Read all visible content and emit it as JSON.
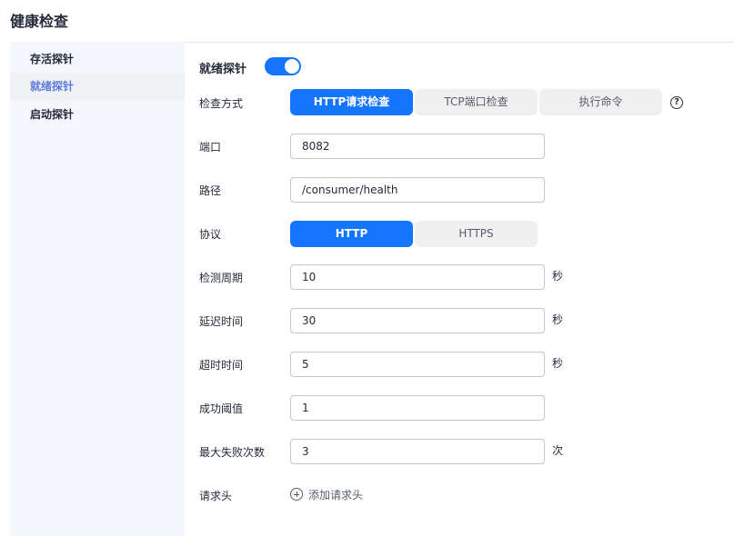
{
  "page": {
    "title": "健康检查"
  },
  "sidebar": {
    "items": [
      {
        "label": "存活探针",
        "active": false
      },
      {
        "label": "就绪探针",
        "active": true
      },
      {
        "label": "启动探针",
        "active": false
      }
    ]
  },
  "probe": {
    "title": "就绪探针",
    "enabled": true
  },
  "form": {
    "check_method": {
      "label": "检查方式",
      "options": [
        "HTTP请求检查",
        "TCP端口检查",
        "执行命令"
      ],
      "selected": "HTTP请求检查",
      "help_icon": "question-circle-icon"
    },
    "port": {
      "label": "端口",
      "value": "8082"
    },
    "path": {
      "label": "路径",
      "value": "/consumer/health"
    },
    "protocol": {
      "label": "协议",
      "options": [
        "HTTP",
        "HTTPS"
      ],
      "selected": "HTTP"
    },
    "period": {
      "label": "检测周期",
      "value": "10",
      "unit": "秒"
    },
    "delay": {
      "label": "延迟时间",
      "value": "30",
      "unit": "秒"
    },
    "timeout": {
      "label": "超时时间",
      "value": "5",
      "unit": "秒"
    },
    "success_threshold": {
      "label": "成功阈值",
      "value": "1"
    },
    "max_failures": {
      "label": "最大失败次数",
      "value": "3",
      "unit": "次"
    },
    "headers": {
      "label": "请求头",
      "add_label": "添加请求头",
      "add_icon": "plus-circle-icon"
    }
  },
  "colors": {
    "primary": "#1476ff",
    "sidebar_bg": "#f3f6fc",
    "active_text": "#5e7ce0"
  }
}
